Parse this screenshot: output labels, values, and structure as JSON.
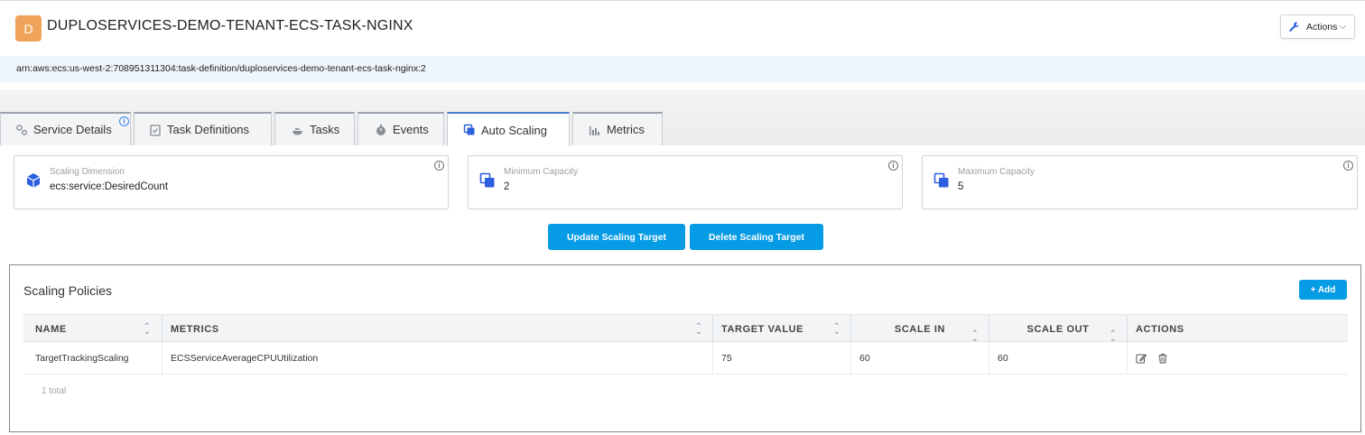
{
  "header": {
    "avatar_letter": "D",
    "title": "DUPLOSERVICES-DEMO-TENANT-ECS-TASK-NGINX",
    "actions_label": "Actions",
    "arn": "arn:aws:ecs:us-west-2:708951311304:task-definition/duploservices-demo-tenant-ecs-task-nginx:2"
  },
  "tabs": [
    {
      "label": "Service Details",
      "icon": "gears-icon"
    },
    {
      "label": "Task Definitions",
      "icon": "clipboard-icon"
    },
    {
      "label": "Tasks",
      "icon": "docker-icon"
    },
    {
      "label": "Events",
      "icon": "stopwatch-icon"
    },
    {
      "label": "Auto Scaling",
      "icon": "copy-icon",
      "active": true
    },
    {
      "label": "Metrics",
      "icon": "bar-chart-icon"
    }
  ],
  "cards": [
    {
      "caption": "Scaling Dimension",
      "value": "ecs:service:DesiredCount"
    },
    {
      "caption": "Minimum Capacity",
      "value": "2"
    },
    {
      "caption": "Maximum Capacity",
      "value": "5"
    }
  ],
  "buttons": {
    "update": "Update Scaling Target",
    "delete": "Delete Scaling Target"
  },
  "policies": {
    "title": "Scaling Policies",
    "add_label": "+ Add",
    "columns": [
      "NAME",
      "METRICS",
      "TARGET VALUE",
      "SCALE IN",
      "SCALE OUT",
      "ACTIONS"
    ],
    "rows": [
      {
        "name": "TargetTrackingScaling",
        "metrics": "ECSServiceAverageCPUUtilization",
        "target_value": "75",
        "scale_in": "60",
        "scale_out": "60"
      }
    ],
    "total": "1 total"
  },
  "colors": {
    "accent": "#069be5",
    "avatar": "#f0a35a",
    "active_tab": "#4a7bd0"
  }
}
